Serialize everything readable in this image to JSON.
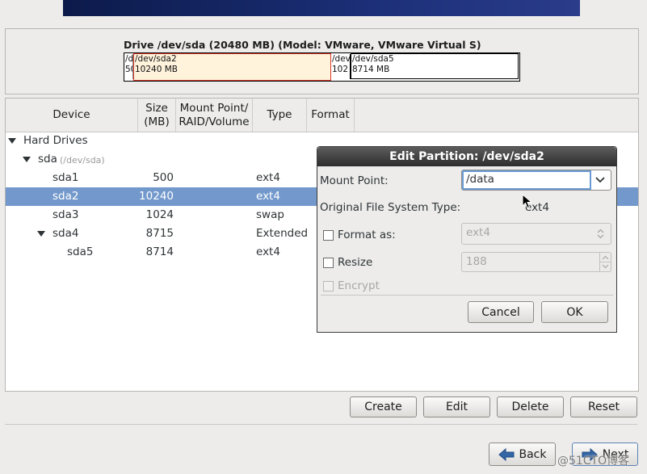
{
  "drive": {
    "title": "Drive /dev/sda (20480 MB) (Model: VMware, VMware Virtual S)",
    "segments": [
      {
        "line1": "/d",
        "line2": "50"
      },
      {
        "line1": "/dev/sda2",
        "line2": "10240 MB"
      },
      {
        "line1": "/dev",
        "line2": "102"
      },
      {
        "line1": "/dev/sda5",
        "line2": "8714 MB"
      }
    ]
  },
  "table": {
    "headers": {
      "device": "Device",
      "size_l1": "Size",
      "size_l2": "(MB)",
      "mount_l1": "Mount Point/",
      "mount_l2": "RAID/Volume",
      "type": "Type",
      "format": "Format"
    },
    "group": "Hard Drives",
    "disk": {
      "name": "sda",
      "path": "(/dev/sda)"
    },
    "rows": [
      {
        "device": "sda1",
        "size": "500",
        "type": "ext4"
      },
      {
        "device": "sda2",
        "size": "10240",
        "type": "ext4"
      },
      {
        "device": "sda3",
        "size": "1024",
        "type": "swap"
      },
      {
        "device": "sda4",
        "size": "8715",
        "type": "Extended"
      },
      {
        "device": "sda5",
        "size": "8714",
        "type": "ext4"
      }
    ]
  },
  "buttons": {
    "create": "Create",
    "edit": "Edit",
    "delete": "Delete",
    "reset": "Reset",
    "back": "Back",
    "next": "Next"
  },
  "dialog": {
    "title": "Edit Partition: /dev/sda2",
    "mount_label": "Mount Point:",
    "mount_value": "/data",
    "orig_fs_label": "Original File System Type:",
    "orig_fs_value": "ext4",
    "format_label": "Format as:",
    "format_value": "ext4",
    "resize_label": "Resize",
    "resize_value": "188",
    "encrypt_label": "Encrypt",
    "cancel": "Cancel",
    "ok": "OK"
  },
  "watermark": "@51CTO博客",
  "colors": {
    "selection": "#7399cc",
    "selected_segment_border": "#d6382a",
    "selected_segment_fill": "#fff3dc"
  }
}
